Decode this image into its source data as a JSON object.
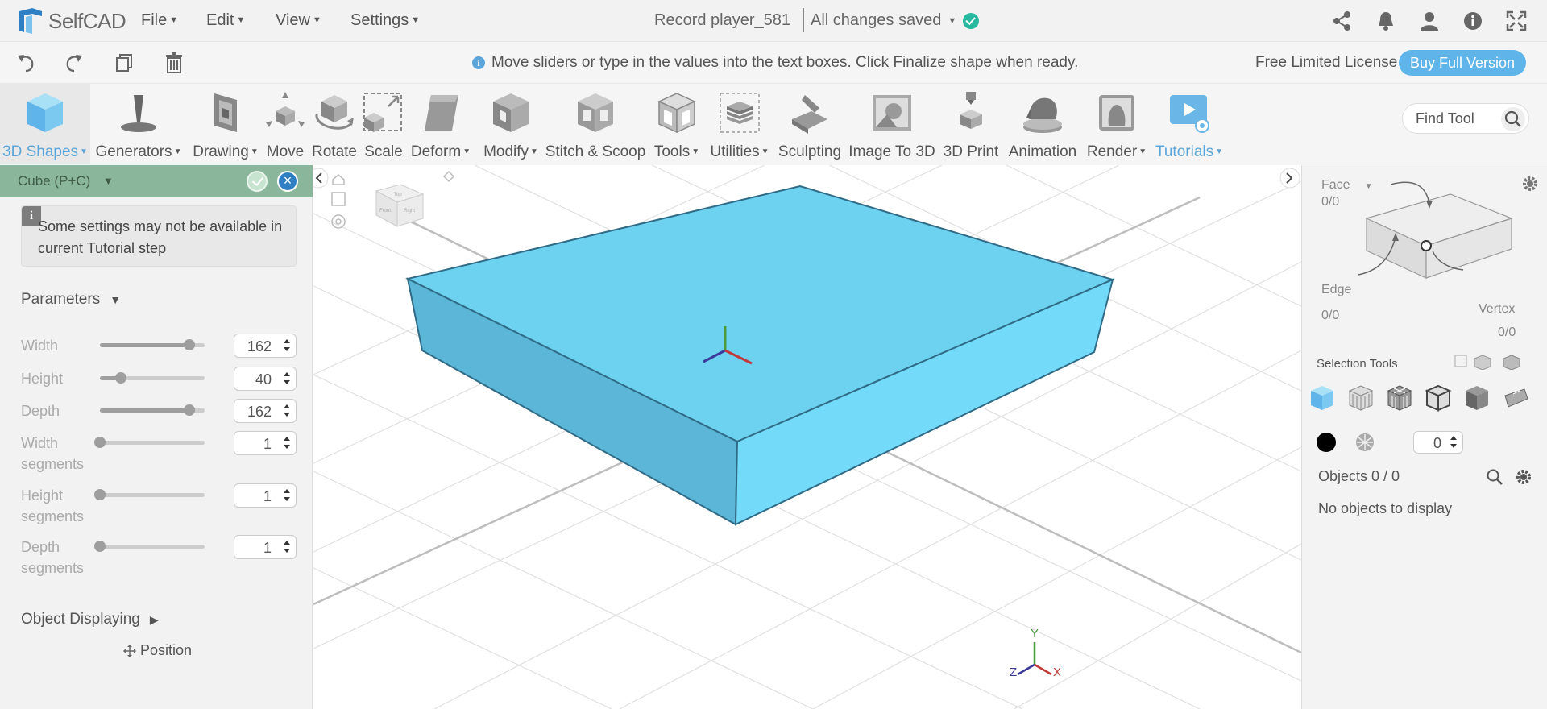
{
  "app": {
    "name": "SelfCAD",
    "brand_color": "#2f7fc4"
  },
  "menus": [
    {
      "label": "File"
    },
    {
      "label": "Edit"
    },
    {
      "label": "View"
    },
    {
      "label": "Settings"
    }
  ],
  "document": {
    "title": "Record player_581",
    "status": "All changes saved",
    "status_color": "#27b9a0"
  },
  "top_icons": [
    "share-icon",
    "bell-icon",
    "user-icon",
    "help-icon",
    "fullscreen-icon"
  ],
  "hint": {
    "text": "Move sliders or type in the values into the text boxes. Click Finalize shape when ready."
  },
  "license": {
    "text": "Free Limited License",
    "buy_label": "Buy Full Version",
    "buy_color": "#5fb5ea"
  },
  "toolbar": {
    "tools": [
      {
        "label": "3D Shapes",
        "icon": "cube-icon",
        "dropdown": true,
        "active": true,
        "blue": true
      },
      {
        "label": "Generators",
        "icon": "generator-icon",
        "dropdown": true
      },
      {
        "label": "Drawing",
        "icon": "drawing-icon",
        "dropdown": true
      },
      {
        "label": "Move",
        "icon": "move-icon"
      },
      {
        "label": "Rotate",
        "icon": "rotate-icon"
      },
      {
        "label": "Scale",
        "icon": "scale-icon"
      },
      {
        "label": "Deform",
        "icon": "deform-icon",
        "dropdown": true
      },
      {
        "label": "Modify",
        "icon": "modify-icon",
        "dropdown": true
      },
      {
        "label": "Stitch & Scoop",
        "icon": "stitch-scoop-icon"
      },
      {
        "label": "Tools",
        "icon": "tools-icon",
        "dropdown": true
      },
      {
        "label": "Utilities",
        "icon": "utilities-icon",
        "dropdown": true
      },
      {
        "label": "Sculpting",
        "icon": "sculpting-icon"
      },
      {
        "label": "Image To 3D",
        "icon": "image-to-3d-icon"
      },
      {
        "label": "3D Print",
        "icon": "3d-print-icon"
      },
      {
        "label": "Animation",
        "icon": "animation-icon"
      },
      {
        "label": "Render",
        "icon": "render-icon",
        "dropdown": true
      },
      {
        "label": "Tutorials",
        "icon": "tutorials-icon",
        "dropdown": true,
        "blue": true
      }
    ],
    "find_placeholder": "Find Tool"
  },
  "left_panel": {
    "header": "Cube (P+C)",
    "header_color": "#8ab79c",
    "tutorial_note": "Some settings may not be available in current Tutorial step",
    "parameters_title": "Parameters",
    "params": [
      {
        "label": "Width",
        "value": "162",
        "fraction": 0.85
      },
      {
        "label": "Height",
        "value": "40",
        "fraction": 0.2
      },
      {
        "label": "Depth",
        "value": "162",
        "fraction": 0.85
      },
      {
        "label": "Width segments",
        "value": "1",
        "fraction": 0
      },
      {
        "label": "Height segments",
        "value": "1",
        "fraction": 0
      },
      {
        "label": "Depth segments",
        "value": "1",
        "fraction": 0
      }
    ],
    "object_displaying": "Object Displaying",
    "position_label": "Position"
  },
  "viewport": {
    "cube_color": "#6dd2f0",
    "axes": {
      "x": "X",
      "y": "Y",
      "z": "Z"
    },
    "view_cube_faces": [
      "Top",
      "Front",
      "Right"
    ]
  },
  "right_panel": {
    "face_label": "Face",
    "face_count": "0/0",
    "edge_label": "Edge",
    "edge_count": "0/0",
    "vertex_label": "Vertex",
    "vertex_count": "0/0",
    "selection_tools": "Selection Tools",
    "selection_value": "0",
    "objects_label": "Objects 0 / 0",
    "no_objects": "No objects to display"
  }
}
